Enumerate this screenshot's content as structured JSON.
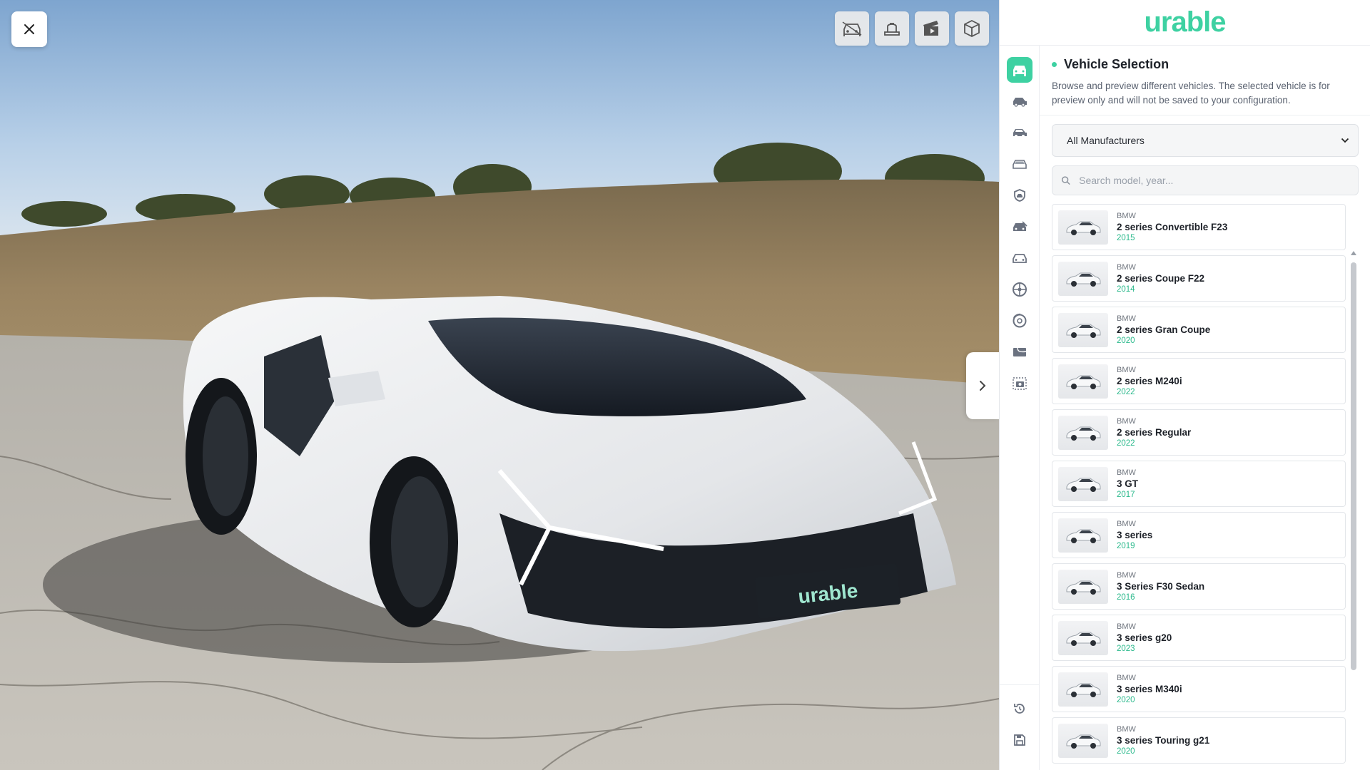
{
  "brand": {
    "logo_text": "urable",
    "color": "#3ed1a2"
  },
  "viewer": {
    "plate_text": "urable",
    "tools": [
      "car-interior-icon",
      "seat-icon",
      "clapperboard-icon",
      "cube-3d-icon"
    ]
  },
  "rail": {
    "icons": [
      "car-front-icon",
      "car-side-icon",
      "car-side-tint-icon",
      "car-glass-icon",
      "shield-icon",
      "car-wrap-icon",
      "car-outline-icon",
      "wheel-icon",
      "brake-rotor-icon",
      "film-roll-icon",
      "camera-icon"
    ],
    "bottom_icons": [
      "history-icon",
      "save-icon"
    ],
    "active_index": 0
  },
  "section": {
    "title": "Vehicle Selection",
    "description": "Browse and preview different vehicles. The selected vehicle is for preview only and will not be saved to your configuration."
  },
  "filter": {
    "selected": "All Manufacturers"
  },
  "search": {
    "placeholder": "Search model, year..."
  },
  "vehicles": [
    {
      "make": "BMW",
      "model": "2 series Convertible F23",
      "year": "2015"
    },
    {
      "make": "BMW",
      "model": "2 series Coupe F22",
      "year": "2014"
    },
    {
      "make": "BMW",
      "model": "2 series Gran Coupe",
      "year": "2020"
    },
    {
      "make": "BMW",
      "model": "2 series M240i",
      "year": "2022"
    },
    {
      "make": "BMW",
      "model": "2 series Regular",
      "year": "2022"
    },
    {
      "make": "BMW",
      "model": "3 GT",
      "year": "2017"
    },
    {
      "make": "BMW",
      "model": "3 series",
      "year": "2019"
    },
    {
      "make": "BMW",
      "model": "3 Series F30 Sedan",
      "year": "2016"
    },
    {
      "make": "BMW",
      "model": "3 series g20",
      "year": "2023"
    },
    {
      "make": "BMW",
      "model": "3 series M340i",
      "year": "2020"
    },
    {
      "make": "BMW",
      "model": "3 series Touring g21",
      "year": "2020"
    }
  ]
}
